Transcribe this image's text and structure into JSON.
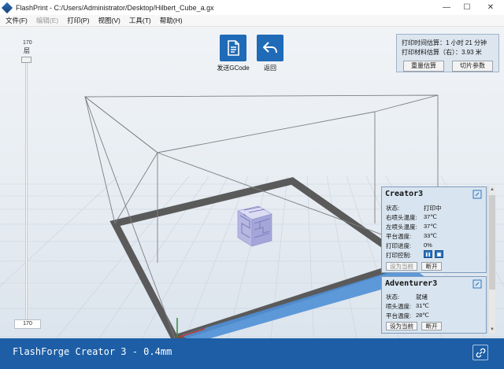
{
  "window": {
    "title": "FlashPrint - C:/Users/Administrator/Desktop/Hilbert_Cube_a.gx",
    "minimize_glyph": "—",
    "maximize_glyph": "☐",
    "close_glyph": "✕"
  },
  "menu": {
    "items": [
      {
        "label": "文件(F)",
        "enabled": true
      },
      {
        "label": "编辑(E)",
        "enabled": false
      },
      {
        "label": "打印(P)",
        "enabled": true
      },
      {
        "label": "视图(V)",
        "enabled": true
      },
      {
        "label": "工具(T)",
        "enabled": true
      },
      {
        "label": "帮助(H)",
        "enabled": true
      }
    ]
  },
  "layer_slider": {
    "top_value": "170",
    "title": "层",
    "bottom_value": "170",
    "level": 1.0
  },
  "toolbar": {
    "send_gcode_label": "发送GCode",
    "back_label": "返回",
    "send_icon": "gcode-file-icon",
    "back_icon": "return-arrow-icon"
  },
  "estimate": {
    "time_line": "打印时间估算：1 小时 21 分钟",
    "material_line": "打印材料估算（右）：3.93 米",
    "re_estimate_label": "重量估算",
    "slice_params_label": "切片参数"
  },
  "printers": [
    {
      "name": "Creator3",
      "rows": [
        {
          "label": "状态:",
          "value": "打印中"
        },
        {
          "label": "右喷头温度:",
          "value": "37℃"
        },
        {
          "label": "左喷头温度:",
          "value": "37℃"
        },
        {
          "label": "平台温度:",
          "value": "33℃"
        },
        {
          "label": "打印进度:",
          "value": "0%"
        },
        {
          "label": "打印控制:",
          "value": ""
        }
      ],
      "set_current_label": "设为当前",
      "disconnect_label": "断开"
    },
    {
      "name": "Adventurer3",
      "rows": [
        {
          "label": "状态:",
          "value": "就绪"
        },
        {
          "label": "喷头温度:",
          "value": "31℃"
        },
        {
          "label": "平台温度:",
          "value": "28℃"
        }
      ],
      "set_current_label": "设为当前",
      "disconnect_label": "断开"
    }
  ],
  "status_bar": {
    "text": "FlashForge Creator 3 - 0.4mm",
    "link_icon": "link-icon"
  },
  "colors": {
    "accent": "#1f6bb8",
    "status_bar": "#1d5ea6",
    "platform_border": "#5a5a5a",
    "axis_blue": "#4f8fd6",
    "model": "#b8b9e3"
  }
}
